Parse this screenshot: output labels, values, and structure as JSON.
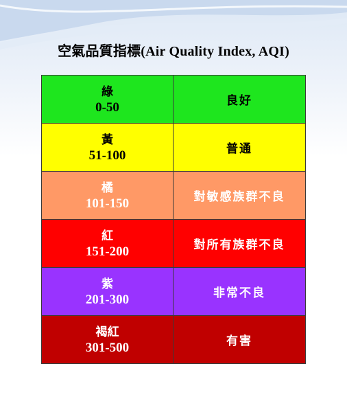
{
  "title": "空氣品質指標(Air Quality Index, AQI)",
  "rows": [
    {
      "level": "綠",
      "range": "0-50",
      "description": "良好",
      "color": "#1ee61e",
      "text_color": "#000000"
    },
    {
      "level": "黃",
      "range": "51-100",
      "description": "普通",
      "color": "#ffff00",
      "text_color": "#000000"
    },
    {
      "level": "橘",
      "range": "101-150",
      "description": "對敏感族群不良",
      "color": "#ff9966",
      "text_color": "#ffffff"
    },
    {
      "level": "紅",
      "range": "151-200",
      "description": "對所有族群不良",
      "color": "#ff0000",
      "text_color": "#ffffff"
    },
    {
      "level": "紫",
      "range": "201-300",
      "description": "非常不良",
      "color": "#9933ff",
      "text_color": "#ffffff"
    },
    {
      "level": "褐紅",
      "range": "301-500",
      "description": "有害",
      "color": "#c00000",
      "text_color": "#ffffff"
    }
  ]
}
